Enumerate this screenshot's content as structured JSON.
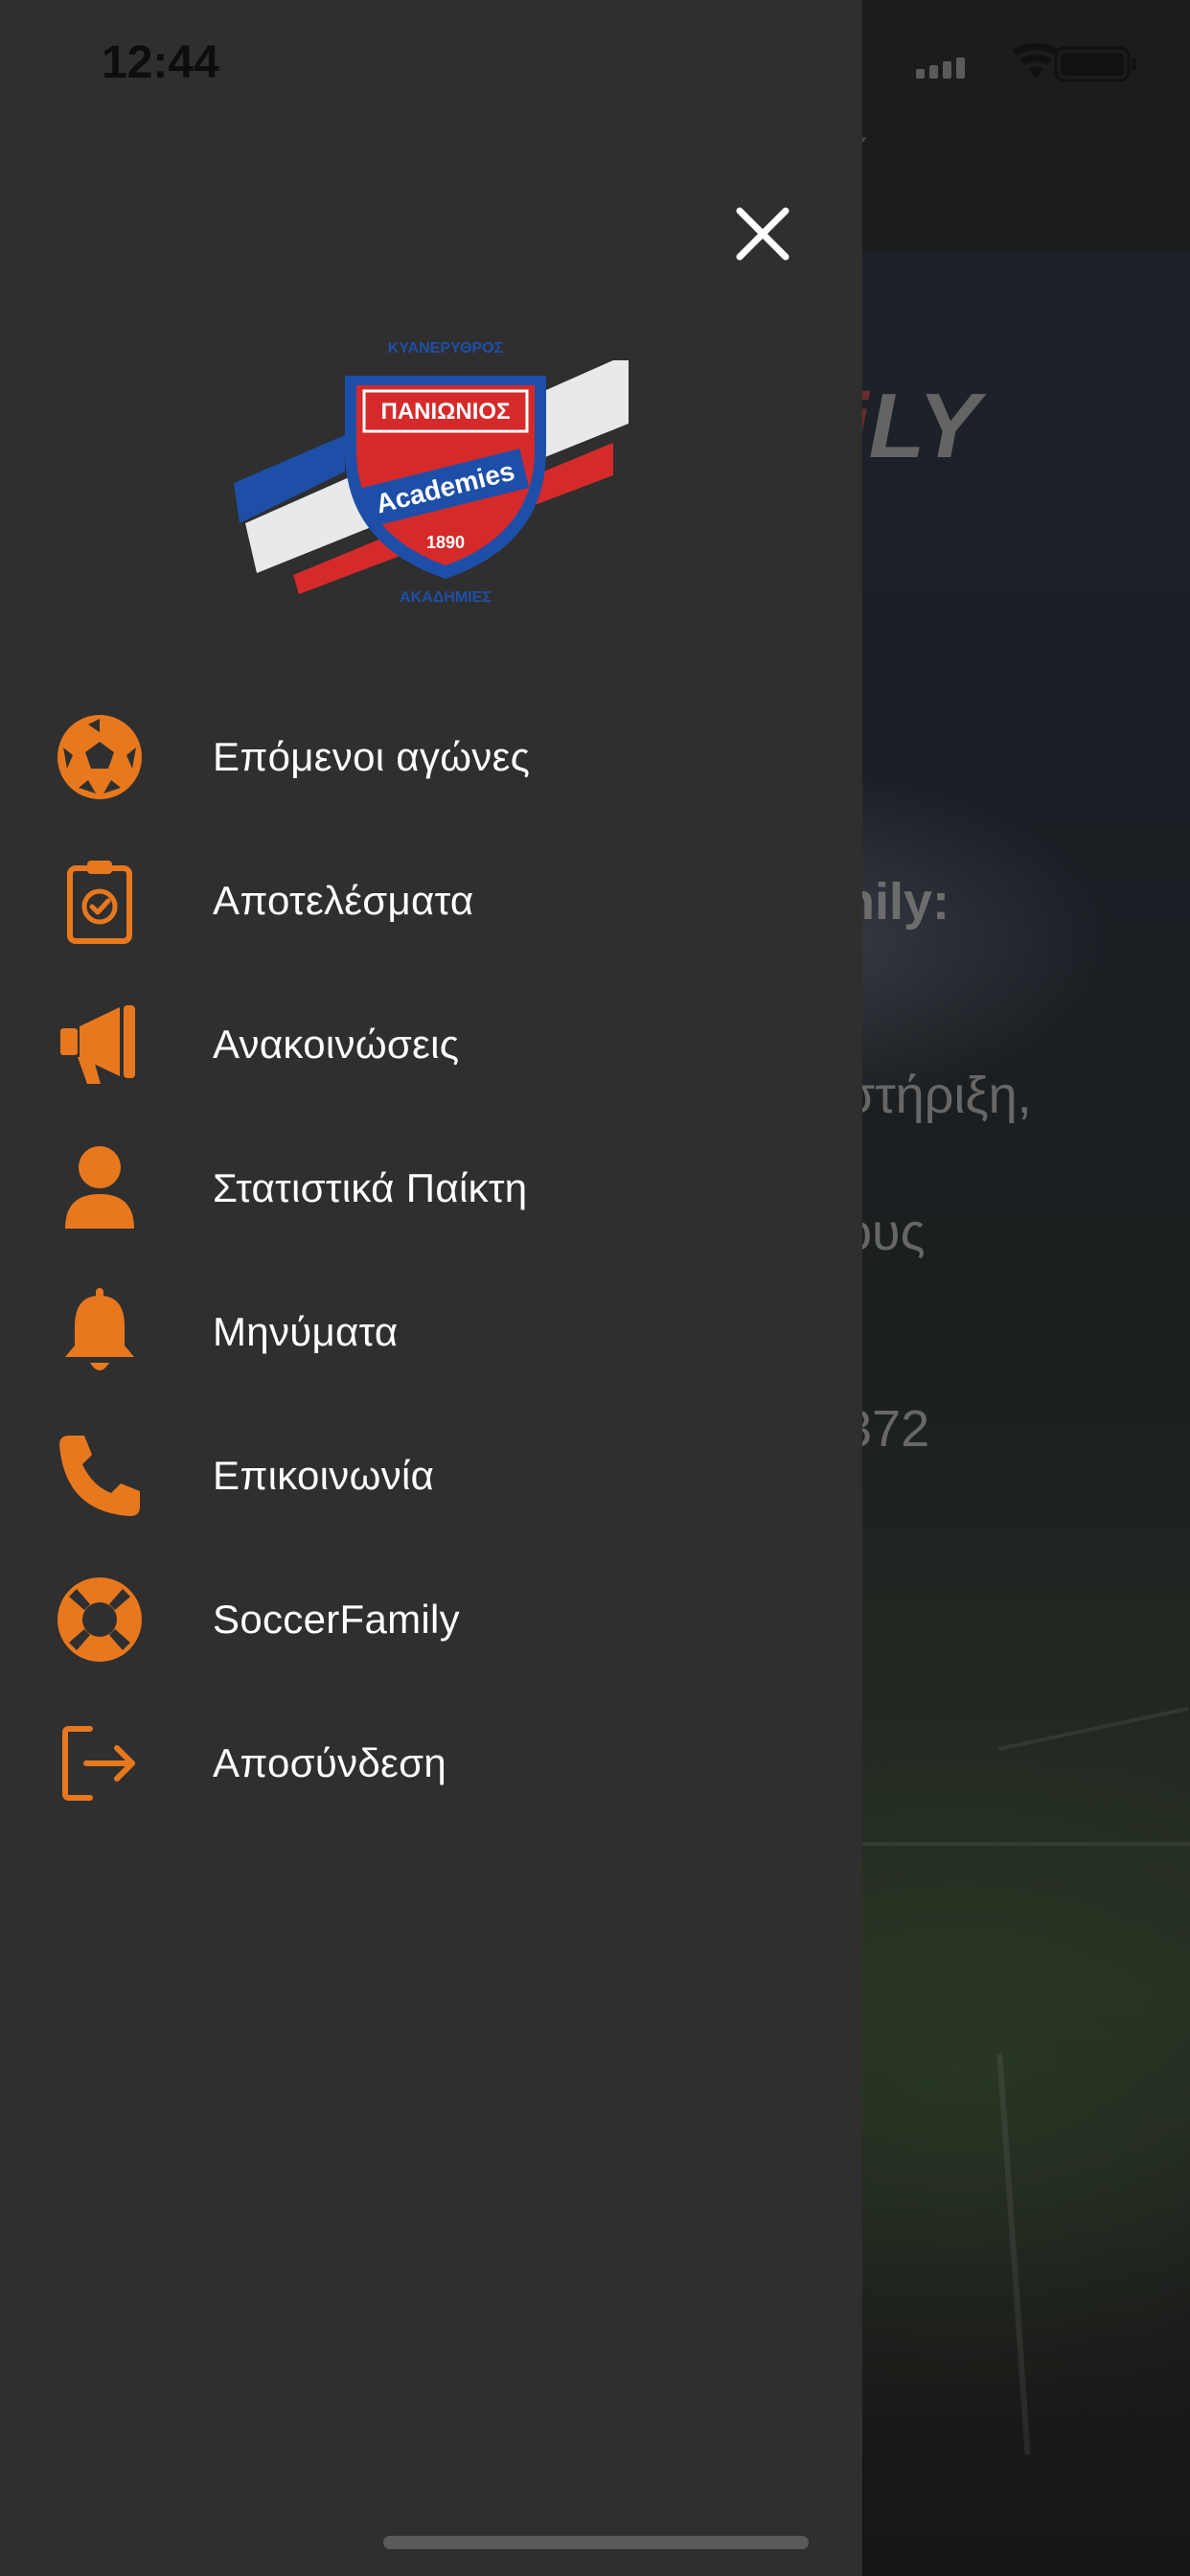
{
  "status_bar": {
    "time": "12:44"
  },
  "background_app": {
    "header_fragment": "Y",
    "logo_fragment_accent": "i",
    "logo_fragment": "LY",
    "lines": [
      "nily:",
      "στήριξη,",
      "ους",
      "372"
    ]
  },
  "drawer": {
    "crest": {
      "top_text": "ΚΥΑΝΕΡΥΘΡΟΣ",
      "club_name": "ΠΑΝΙΩΝΙΟΣ",
      "academies": "Academies",
      "year": "1890",
      "bottom_text": "ΑΚΑΔΗΜΙΕΣ"
    },
    "menu": [
      {
        "label": "Επόμενοι αγώνες",
        "icon": "soccer-ball-icon"
      },
      {
        "label": "Αποτελέσματα",
        "icon": "clipboard-check-icon"
      },
      {
        "label": "Ανακοινώσεις",
        "icon": "megaphone-icon"
      },
      {
        "label": "Στατιστικά Παίκτη",
        "icon": "user-icon"
      },
      {
        "label": "Μηνύματα",
        "icon": "bell-icon"
      },
      {
        "label": "Επικοινωνία",
        "icon": "phone-icon"
      },
      {
        "label": "SoccerFamily",
        "icon": "lifebuoy-icon"
      },
      {
        "label": "Αποσύνδεση",
        "icon": "logout-icon"
      }
    ]
  },
  "colors": {
    "accent": "#E8781E",
    "drawer_bg": "#2F2F2F",
    "text": "#FFFFFF"
  }
}
